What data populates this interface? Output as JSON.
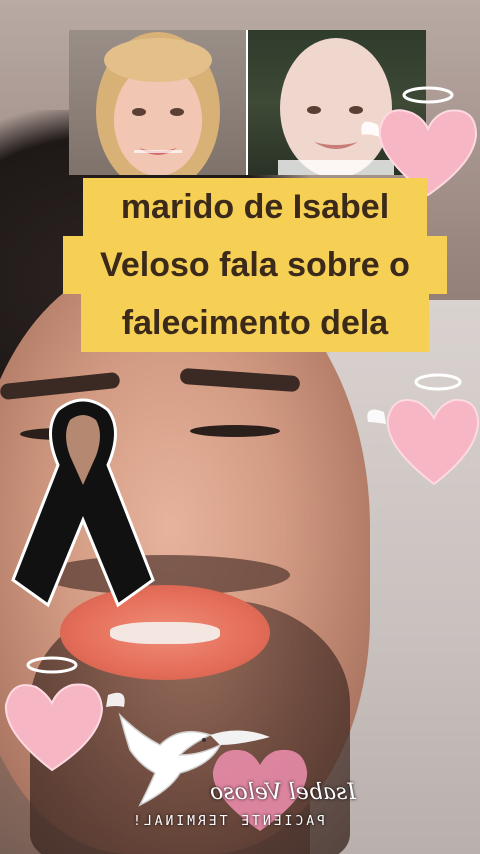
{
  "caption": {
    "line1": "marido de Isabel",
    "line2": "Veloso fala sobre o",
    "line3": "falecimento dela"
  },
  "photos": {
    "left": "portrait-woman-smiling",
    "right": "portrait-woman-bald-smiling"
  },
  "stickers": [
    "mourning-ribbon-icon",
    "angel-heart-icon",
    "dove-icon"
  ],
  "logo": {
    "script": "Isabel Veloso",
    "sub": "PACIENTE TERMINAL!"
  },
  "colors": {
    "caption_bg": "#f6cf55",
    "caption_text": "#3b2a1a",
    "heart_pink": "#f7b6c4",
    "ribbon": "#111111"
  }
}
